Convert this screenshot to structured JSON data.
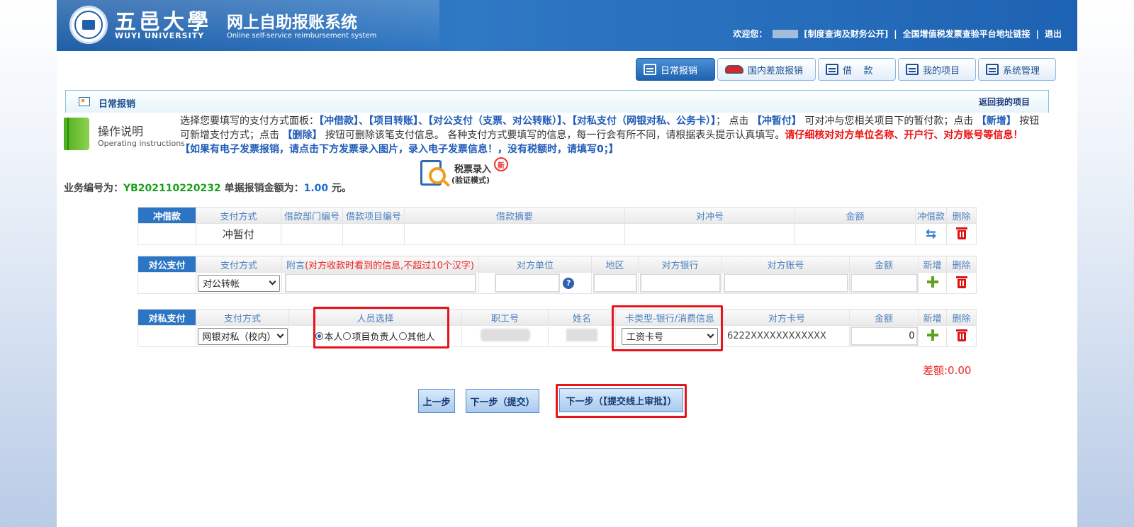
{
  "header": {
    "logo_cn": "五邑大學",
    "logo_en": "WUYI UNIVERSITY",
    "title": "网上自助报账系统",
    "subtitle": "Online self-service reimbursement system",
    "welcome": "欢迎您：",
    "link_policy": "[制度查询及财务公开]",
    "link_vat": "全国增值税发票查验平台地址链接",
    "logout": "退出"
  },
  "nav": [
    {
      "label": "日常报销"
    },
    {
      "label": "国内差旅报销"
    },
    {
      "label": "借    款"
    },
    {
      "label": "我的项目"
    },
    {
      "label": "系统管理"
    }
  ],
  "section": {
    "title": "日常报销",
    "back": "返回我的项目"
  },
  "instructions": {
    "title": "操作说明",
    "subtitle": "Operating instructions",
    "t1": "选择您要填写的支付方式面板：",
    "b1": "【冲借款】、【项目转账】、【对公支付（支票、对公转账）】、【对私支付（网银对私、公务卡）】",
    "t2": "；  点击",
    "b2": "【冲暂付】",
    "t3": "可对冲与您相关项目下的暂付款；点击",
    "b3": "【新增】",
    "t4": "按钮可新增支付方式；点击",
    "b4": "【删除】",
    "t5": "按钮可删除该笔支付信息。 各种支付方式要填写的信息，每一行会有所不同，请根据表头提示认真填写。",
    "r1": "请仔细核对对方单位名称、开户行、对方账号等信息！",
    "b5": "【如果有电子发票报销，请点击下方发票录入图片，录入电子发票信息！，没有税额时，请填写0；】"
  },
  "tax": {
    "line1": "税票录入",
    "line2": "(验证模式)",
    "badge": "新"
  },
  "biz": {
    "label_no": "业务编号为：",
    "no": "YB202110220232",
    "label_amount": "单据报销金额为：",
    "amount": "1.00",
    "unit": "元。"
  },
  "loan_table": {
    "label": "冲借款",
    "headers": [
      "支付方式",
      "借款部门编号",
      "借款项目编号",
      "借款摘要",
      "对冲号",
      "金额",
      "冲借款",
      "删除"
    ],
    "row": {
      "method": "冲暂付"
    }
  },
  "public_table": {
    "label": "对公支付",
    "headers": [
      "支付方式",
      "附言",
      "(对方收款时看到的信息,不超过10个汉字)",
      "对方单位",
      "地区",
      "对方银行",
      "对方账号",
      "金额",
      "新增",
      "删除"
    ],
    "row": {
      "method": "对公转帐"
    }
  },
  "private_table": {
    "label": "对私支付",
    "headers": [
      "支付方式",
      "人员选择",
      "职工号",
      "姓名",
      "卡类型-银行/消费信息",
      "对方卡号",
      "金额",
      "新增",
      "删除"
    ],
    "row": {
      "method": "网银对私（校内）",
      "radio_self": "本人",
      "radio_leader": "项目负责人",
      "radio_other": "其他人",
      "card_type": "工资卡号",
      "card_no": "6222XXXXXXXXXXXX",
      "amount": "0"
    }
  },
  "difference": "差额:0.00",
  "buttons": {
    "prev": "上一步",
    "next_submit": "下一步（提交）",
    "next_online": "下一步（【提交线上审批】）"
  }
}
